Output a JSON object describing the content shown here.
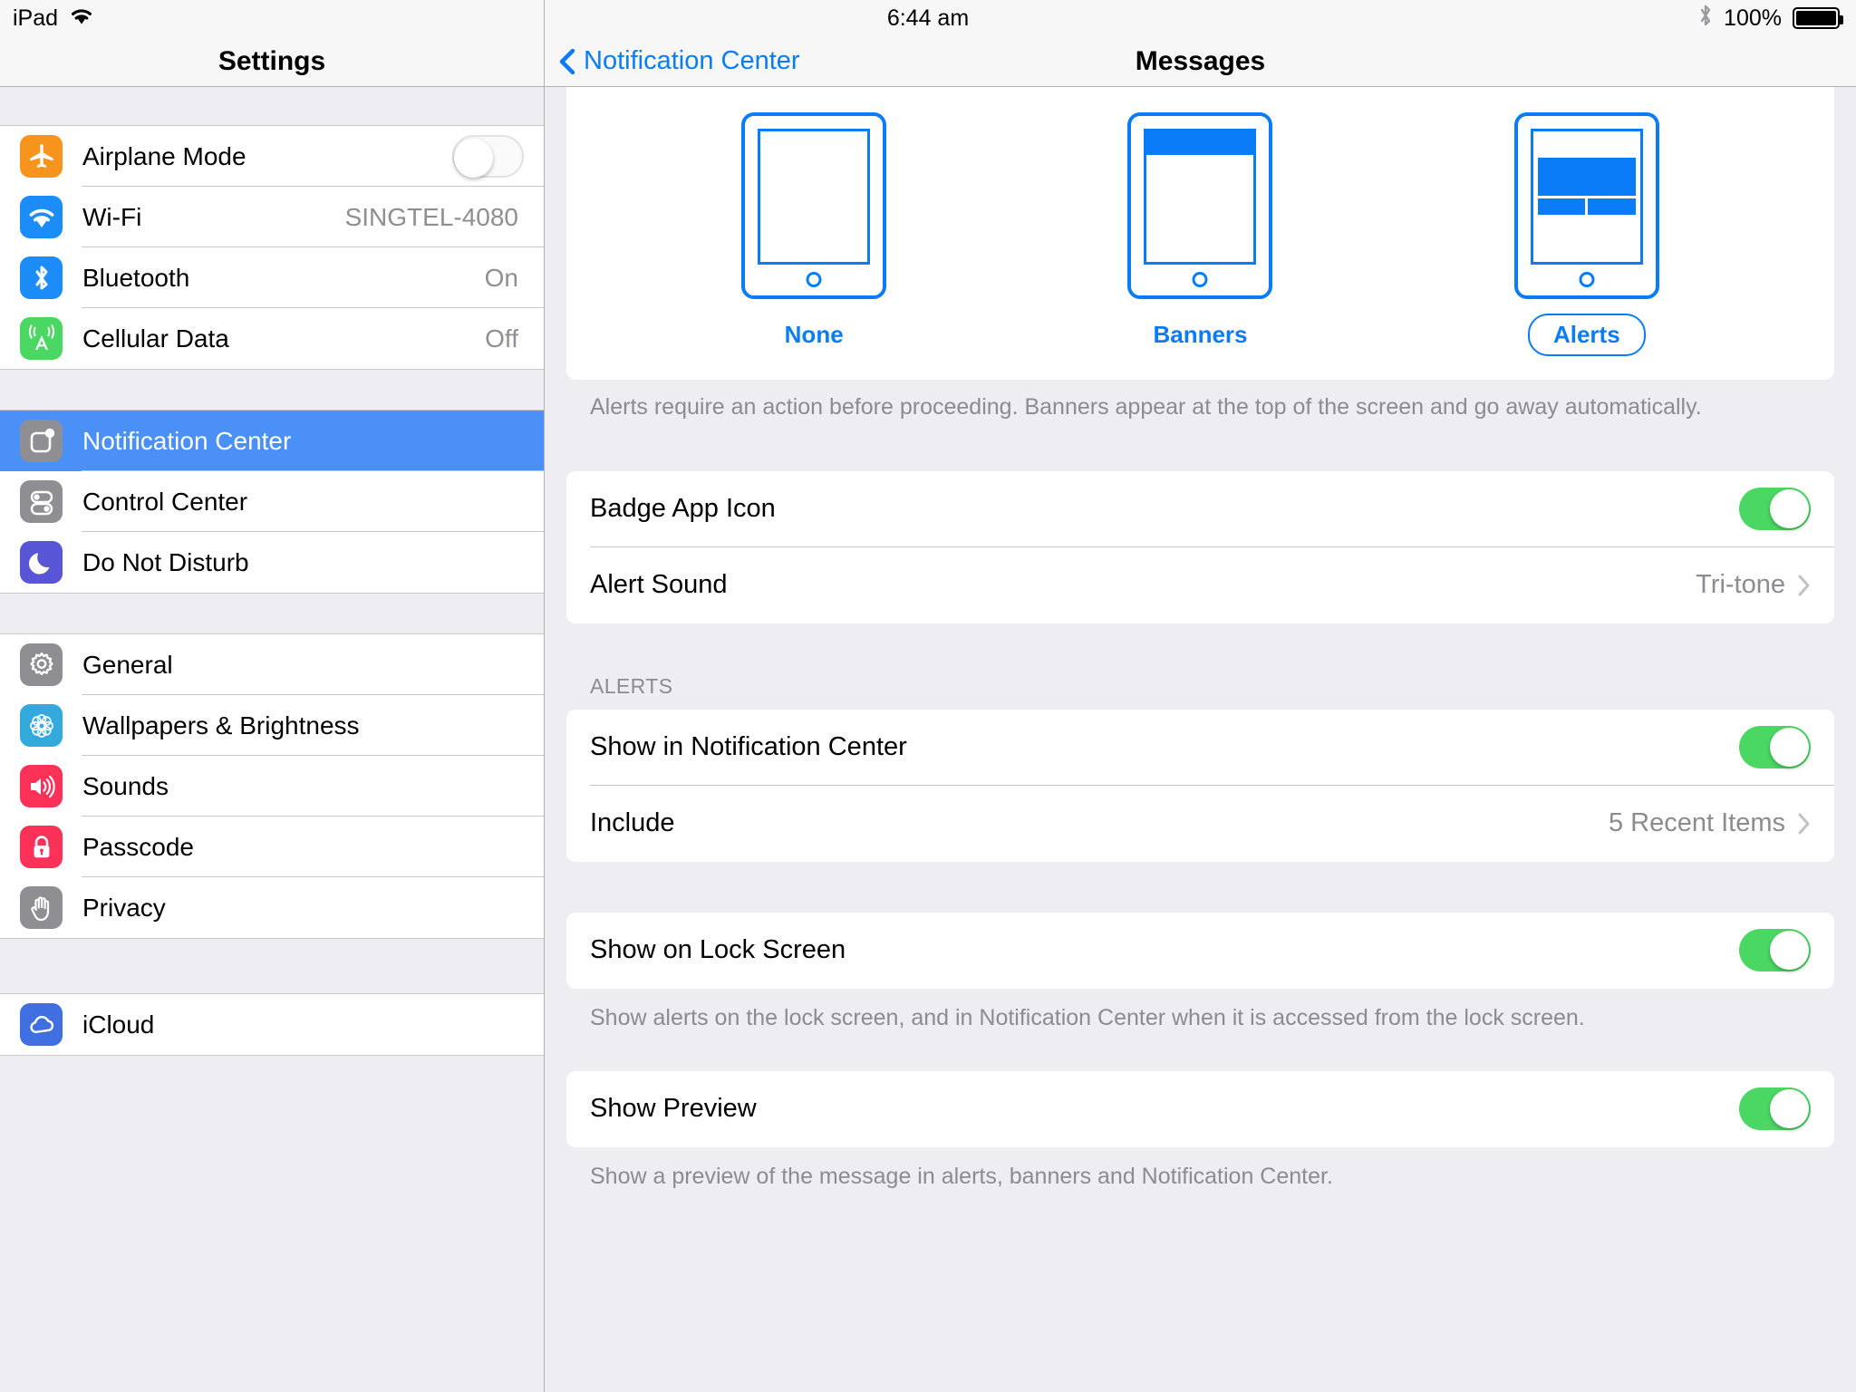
{
  "status_bar": {
    "device": "iPad",
    "wifi_icon": "wifi-icon",
    "time": "6:44 am",
    "bluetooth_icon": "bluetooth-icon",
    "battery_percent": "100%",
    "battery_icon": "battery-full-icon"
  },
  "sidebar": {
    "title": "Settings",
    "groups": [
      {
        "items": [
          {
            "label": "Airplane Mode",
            "icon": "airplane-icon",
            "icon_color": "#f7941e",
            "control": "switch",
            "switch_on": false
          },
          {
            "label": "Wi-Fi",
            "icon": "wifi-icon",
            "icon_color": "#1c8cf8",
            "control": "value",
            "value": "SINGTEL-4080"
          },
          {
            "label": "Bluetooth",
            "icon": "bluetooth-icon",
            "icon_color": "#1c8cf8",
            "control": "value",
            "value": "On"
          },
          {
            "label": "Cellular Data",
            "icon": "cellular-icon",
            "icon_color": "#4bd763",
            "control": "value",
            "value": "Off"
          }
        ]
      },
      {
        "items": [
          {
            "label": "Notification Center",
            "icon": "notification-center-icon",
            "icon_color": "#8e8e93",
            "control": "none",
            "selected": true
          },
          {
            "label": "Control Center",
            "icon": "control-center-icon",
            "icon_color": "#8e8e93",
            "control": "none"
          },
          {
            "label": "Do Not Disturb",
            "icon": "moon-icon",
            "icon_color": "#5856d6",
            "control": "none"
          }
        ]
      },
      {
        "items": [
          {
            "label": "General",
            "icon": "gear-icon",
            "icon_color": "#8e8e93",
            "control": "none"
          },
          {
            "label": "Wallpapers & Brightness",
            "icon": "flower-icon",
            "icon_color": "#34aadc",
            "control": "none"
          },
          {
            "label": "Sounds",
            "icon": "speaker-icon",
            "icon_color": "#fc3158",
            "control": "none"
          },
          {
            "label": "Passcode",
            "icon": "lock-icon",
            "icon_color": "#fc3158",
            "control": "none"
          },
          {
            "label": "Privacy",
            "icon": "hand-icon",
            "icon_color": "#8e8e93",
            "control": "none"
          }
        ]
      },
      {
        "items": [
          {
            "label": "iCloud",
            "icon": "cloud-icon",
            "icon_color": "#3f6fe0",
            "control": "none"
          }
        ]
      }
    ]
  },
  "detail": {
    "back_label": "Notification Center",
    "back_icon": "chevron-left-icon",
    "title": "Messages",
    "alert_style": {
      "options": [
        {
          "label": "None",
          "preview": "none",
          "selected": false
        },
        {
          "label": "Banners",
          "preview": "banner",
          "selected": false
        },
        {
          "label": "Alerts",
          "preview": "alert",
          "selected": true
        }
      ],
      "footnote": "Alerts require an action before proceeding. Banners appear at the top of the screen and go away automatically."
    },
    "section_badge": {
      "rows": [
        {
          "label": "Badge App Icon",
          "control": "switch",
          "switch_on": true
        },
        {
          "label": "Alert Sound",
          "control": "value",
          "value": "Tri-tone",
          "chevron": "chevron-right-icon"
        }
      ]
    },
    "section_alerts": {
      "header": "ALERTS",
      "rows": [
        {
          "label": "Show in Notification Center",
          "control": "switch",
          "switch_on": true
        },
        {
          "label": "Include",
          "control": "value",
          "value": "5 Recent Items",
          "chevron": "chevron-right-icon"
        }
      ]
    },
    "section_lock": {
      "rows": [
        {
          "label": "Show on Lock Screen",
          "control": "switch",
          "switch_on": true
        }
      ],
      "footnote": "Show alerts on the lock screen, and in Notification Center when it is accessed from the lock screen."
    },
    "section_preview": {
      "rows": [
        {
          "label": "Show Preview",
          "control": "switch",
          "switch_on": true
        }
      ],
      "footnote": "Show a preview of the message in alerts, banners and Notification Center."
    }
  },
  "colors": {
    "accent_blue": "#0a7cf7",
    "selection_blue": "#4a90f7",
    "switch_on_green": "#4bd763",
    "muted_gray": "#8b8b91"
  }
}
